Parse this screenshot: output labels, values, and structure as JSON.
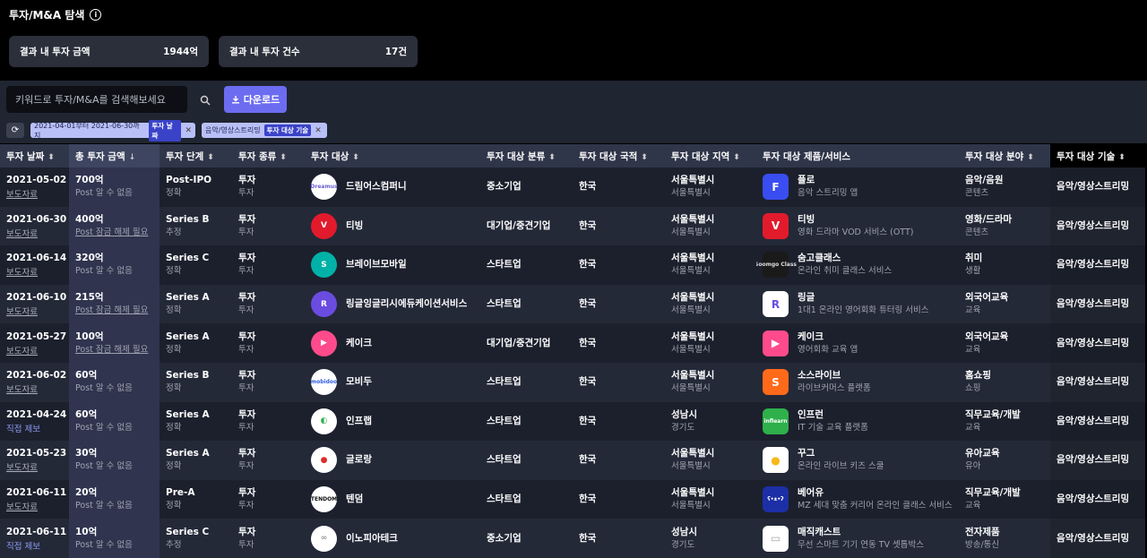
{
  "page": {
    "title": "투자/M&A 탐색"
  },
  "stats": [
    {
      "label": "결과 내 투자 금액",
      "value": "1944억"
    },
    {
      "label": "결과 내 투자 건수",
      "value": "17건"
    }
  ],
  "search": {
    "placeholder": "키워드로 투자/M&A를 검색해보세요"
  },
  "toolbar": {
    "download_label": "다운로드"
  },
  "filters": [
    {
      "text": "2021-04-01부터 2021-06-30까지",
      "tag": "투자 날짜"
    },
    {
      "text": "음악/영상스트리밍",
      "tag": "투자 대상 기술"
    }
  ],
  "columns": [
    "투자 날짜",
    "총 투자 금액",
    "투자 단계",
    "투자 종류",
    "투자 대상",
    "투자 대상 분류",
    "투자 대상 국적",
    "투자 대상 지역",
    "투자 대상 제품/서비스",
    "투자 대상 분야",
    "투자 대상 기술"
  ],
  "rows": [
    {
      "date": "2021-05-02",
      "source": "보도자료",
      "amount": "700억",
      "amount_note": "Post 알 수 없음",
      "stage": "Post-IPO",
      "stage_note": "정확",
      "type": "투자",
      "type_note": "투자",
      "company": "드림어스컴퍼니",
      "logo_text": "Dreamus",
      "category": "중소기업",
      "country": "한국",
      "region": "서울특별시",
      "region_sub": "서울특별시",
      "product": "플로",
      "product_desc": "음악 스트리밍 앱",
      "product_logo": "F",
      "field": "음악/음원",
      "field_sub": "콘텐츠",
      "tech": "음악/영상스트리밍"
    },
    {
      "date": "2021-06-30",
      "source": "보도자료",
      "amount": "400억",
      "amount_note": "Post 잠금 해제 필요",
      "stage": "Series B",
      "stage_note": "추정",
      "type": "투자",
      "type_note": "투자",
      "company": "티빙",
      "logo_text": "V",
      "category": "대기업/중견기업",
      "country": "한국",
      "region": "서울특별시",
      "region_sub": "서울특별시",
      "product": "티빙",
      "product_desc": "영화 드라마 VOD 서비스 (OTT)",
      "product_logo": "V",
      "field": "영화/드라마",
      "field_sub": "콘텐츠",
      "tech": "음악/영상스트리밍"
    },
    {
      "date": "2021-06-14",
      "source": "보도자료",
      "amount": "320억",
      "amount_note": "Post 알 수 없음",
      "stage": "Series C",
      "stage_note": "정확",
      "type": "투자",
      "type_note": "투자",
      "company": "브레이브모바일",
      "logo_text": "S",
      "category": "스타트업",
      "country": "한국",
      "region": "서울특별시",
      "region_sub": "서울특별시",
      "product": "숨고클래스",
      "product_desc": "온라인 취미 클래스 서비스",
      "product_logo": "Soomgo Class",
      "field": "취미",
      "field_sub": "생활",
      "tech": "음악/영상스트리밍"
    },
    {
      "date": "2021-06-10",
      "source": "보도자료",
      "amount": "215억",
      "amount_note": "Post 잠금 해제 필요",
      "stage": "Series A",
      "stage_note": "정확",
      "type": "투자",
      "type_note": "투자",
      "company": "링글잉글리시에듀케이션서비스",
      "logo_text": "R",
      "category": "스타트업",
      "country": "한국",
      "region": "서울특별시",
      "region_sub": "서울특별시",
      "product": "링글",
      "product_desc": "1대1 온라인 영어회화 튜터링 서비스",
      "product_logo": "R",
      "field": "외국어교육",
      "field_sub": "교육",
      "tech": "음악/영상스트리밍"
    },
    {
      "date": "2021-05-27",
      "source": "보도자료",
      "amount": "100억",
      "amount_note": "Post 잠금 해제 필요",
      "stage": "Series A",
      "stage_note": "정확",
      "type": "투자",
      "type_note": "투자",
      "company": "케이크",
      "logo_text": "▶",
      "category": "대기업/중견기업",
      "country": "한국",
      "region": "서울특별시",
      "region_sub": "서울특별시",
      "product": "케이크",
      "product_desc": "영어회화 교육 앱",
      "product_logo": "▶",
      "field": "외국어교육",
      "field_sub": "교육",
      "tech": "음악/영상스트리밍"
    },
    {
      "date": "2021-06-02",
      "source": "보도자료",
      "amount": "60억",
      "amount_note": "Post 알 수 없음",
      "stage": "Series B",
      "stage_note": "정확",
      "type": "투자",
      "type_note": "투자",
      "company": "모비두",
      "logo_text": "mobidoo",
      "category": "스타트업",
      "country": "한국",
      "region": "서울특별시",
      "region_sub": "서울특별시",
      "product": "소스라이브",
      "product_desc": "라이브커머스 플랫폼",
      "product_logo": "S",
      "field": "홈쇼핑",
      "field_sub": "쇼핑",
      "tech": "음악/영상스트리밍"
    },
    {
      "date": "2021-04-24",
      "source": "직접 제보",
      "amount": "60억",
      "amount_note": "Post 알 수 없음",
      "stage": "Series A",
      "stage_note": "정확",
      "type": "투자",
      "type_note": "투자",
      "company": "인프랩",
      "logo_text": "◐",
      "category": "스타트업",
      "country": "한국",
      "region": "성남시",
      "region_sub": "경기도",
      "product": "인프런",
      "product_desc": "IT 기술 교육 플랫폼",
      "product_logo": "inflearn",
      "field": "직무교육/개발",
      "field_sub": "교육",
      "tech": "음악/영상스트리밍"
    },
    {
      "date": "2021-05-23",
      "source": "보도자료",
      "amount": "30억",
      "amount_note": "Post 알 수 없음",
      "stage": "Series A",
      "stage_note": "정확",
      "type": "투자",
      "type_note": "투자",
      "company": "글로랑",
      "logo_text": "●",
      "category": "스타트업",
      "country": "한국",
      "region": "서울특별시",
      "region_sub": "서울특별시",
      "product": "꾸그",
      "product_desc": "온라인 라이브 키즈 스쿨",
      "product_logo": "●",
      "field": "유아교육",
      "field_sub": "유아",
      "tech": "음악/영상스트리밍"
    },
    {
      "date": "2021-06-11",
      "source": "보도자료",
      "amount": "20억",
      "amount_note": "Post 알 수 없음",
      "stage": "Pre-A",
      "stage_note": "정확",
      "type": "투자",
      "type_note": "투자",
      "company": "텐덤",
      "logo_text": "TENDOM",
      "category": "스타트업",
      "country": "한국",
      "region": "서울특별시",
      "region_sub": "서울특별시",
      "product": "베어유",
      "product_desc": "MZ 세대 맞춤 커리어 온라인 클래스 서비스",
      "product_logo": "ʕ•ᴥ•ʔ",
      "field": "직무교육/개발",
      "field_sub": "교육",
      "tech": "음악/영상스트리밍"
    },
    {
      "date": "2021-06-11",
      "source": "직접 제보",
      "amount": "10억",
      "amount_note": "Post 알 수 없음",
      "stage": "Series C",
      "stage_note": "추정",
      "type": "투자",
      "type_note": "투자",
      "company": "이노피아테크",
      "logo_text": "∞",
      "category": "중소기업",
      "country": "한국",
      "region": "성남시",
      "region_sub": "경기도",
      "product": "매직캐스트",
      "product_desc": "무선 스마트 기기 연동 TV 셋톱박스",
      "product_logo": "▭",
      "field": "전자제품",
      "field_sub": "방송/통신",
      "tech": "음악/영상스트리밍"
    }
  ],
  "colors": {
    "accent": "#6c6cf0",
    "background": "#000000",
    "header": "#30364a"
  }
}
